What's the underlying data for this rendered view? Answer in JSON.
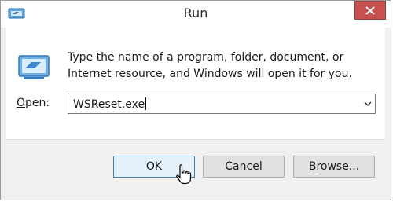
{
  "window": {
    "title": "Run"
  },
  "description": "Type the name of a program, folder, document, or Internet resource, and Windows will open it for you.",
  "open": {
    "label_mnemonic": "O",
    "label_rest": "pen:",
    "value": "WSReset.exe"
  },
  "buttons": {
    "ok": "OK",
    "cancel": "Cancel",
    "browse_mnemonic": "B",
    "browse_rest": "rowse..."
  },
  "colors": {
    "close_button": "#c75050",
    "ok_border": "#3c7fb1",
    "ok_fill": "#e5f1fb"
  },
  "icons": [
    "run-app-icon",
    "close-icon",
    "run-dialog-icon",
    "dropdown-arrow-icon",
    "mouse-pointer-icon"
  ]
}
